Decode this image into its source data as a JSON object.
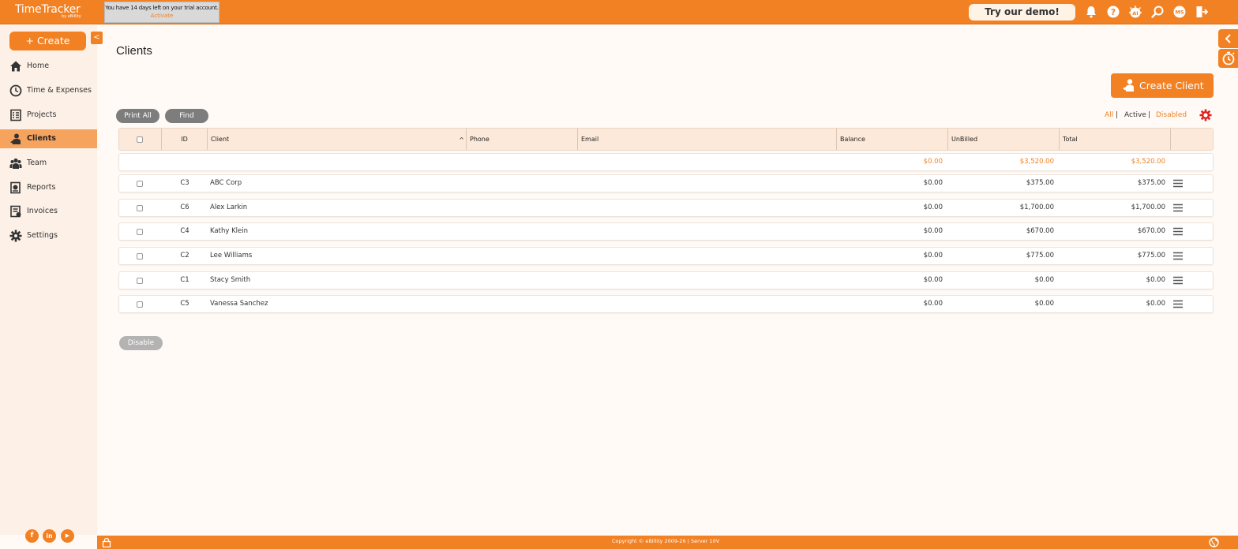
{
  "app": {
    "logo": "TimeTracker",
    "logo_sub": "by eBillity"
  },
  "trial": {
    "message": "You have 14 days left on your trial account.",
    "activate": "Activate"
  },
  "topbar": {
    "demo_label": "Try our demo!",
    "avatar_initials": "MS",
    "ai_badge": "AI"
  },
  "sidebar": {
    "create_label": "+ Create",
    "collapse_glyph": "<",
    "items": [
      {
        "label": "Home",
        "icon": "home-icon"
      },
      {
        "label": "Time & Expenses",
        "icon": "clock-icon"
      },
      {
        "label": "Projects",
        "icon": "projects-icon"
      },
      {
        "label": "Clients",
        "icon": "client-icon",
        "active": true
      },
      {
        "label": "Team",
        "icon": "team-icon"
      },
      {
        "label": "Reports",
        "icon": "reports-icon"
      },
      {
        "label": "Invoices",
        "icon": "invoices-icon"
      },
      {
        "label": "Settings",
        "icon": "gear-icon"
      }
    ],
    "social": {
      "facebook": "f",
      "linkedin": "in",
      "youtube": "▶"
    }
  },
  "main": {
    "title": "Clients",
    "create_client_label": "Create Client",
    "print_all_label": "Print All",
    "find_label": "Find",
    "filters": {
      "all": "All",
      "active": "Active",
      "disabled": "Disabled",
      "separator": "|"
    },
    "disable_label": "Disable"
  },
  "table": {
    "columns": {
      "id": "ID",
      "client": "Client",
      "phone": "Phone",
      "email": "Email",
      "balance": "Balance",
      "unbilled": "UnBilled",
      "total": "Total"
    },
    "sort_indicator": "^",
    "totals": {
      "balance": "$0.00",
      "unbilled": "$3,520.00",
      "total": "$3,520.00"
    },
    "rows": [
      {
        "id": "C3",
        "client": "ABC Corp",
        "phone": "",
        "email": "",
        "balance": "$0.00",
        "unbilled": "$375.00",
        "total": "$375.00"
      },
      {
        "id": "C6",
        "client": "Alex Larkin",
        "phone": "",
        "email": "",
        "balance": "$0.00",
        "unbilled": "$1,700.00",
        "total": "$1,700.00"
      },
      {
        "id": "C4",
        "client": "Kathy Klein",
        "phone": "",
        "email": "",
        "balance": "$0.00",
        "unbilled": "$670.00",
        "total": "$670.00"
      },
      {
        "id": "C2",
        "client": "Lee Williams",
        "phone": "",
        "email": "",
        "balance": "$0.00",
        "unbilled": "$775.00",
        "total": "$775.00"
      },
      {
        "id": "C1",
        "client": "Stacy Smith",
        "phone": "",
        "email": "",
        "balance": "$0.00",
        "unbilled": "$0.00",
        "total": "$0.00"
      },
      {
        "id": "C5",
        "client": "Vanessa Sanchez",
        "phone": "",
        "email": "",
        "balance": "$0.00",
        "unbilled": "$0.00",
        "total": "$0.00"
      }
    ]
  },
  "footer": {
    "copyright": "Copyright © eBillity 2009-26  |  Server 10V"
  },
  "colors": {
    "brand": "#f28123",
    "sidebar_bg": "#fdf0e6",
    "active_nav": "#f6a35e",
    "header_row": "#fde9da"
  }
}
